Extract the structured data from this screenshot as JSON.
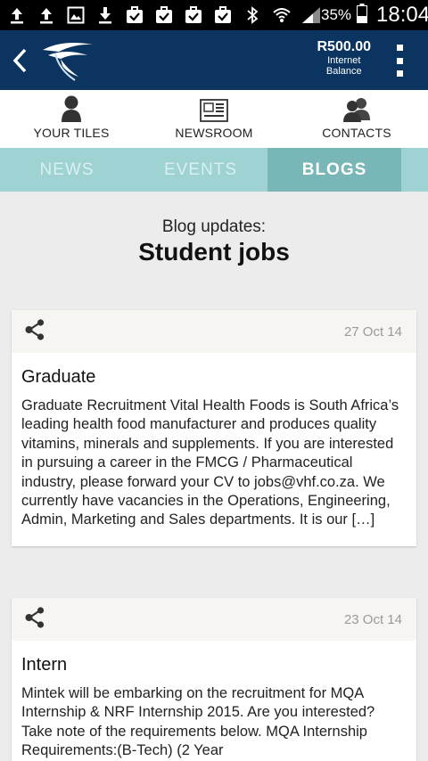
{
  "status_bar": {
    "icons": [
      "upload-icon",
      "upload-icon",
      "image-icon",
      "download-icon",
      "task-check-icon",
      "task-check-icon",
      "task-check-icon",
      "task-check-icon",
      "bluetooth-icon",
      "wifi-icon",
      "signal-icon"
    ],
    "battery": "35%",
    "time": "18:04"
  },
  "app_bar": {
    "balance_amount": "R500.00",
    "balance_label_1": "Internet",
    "balance_label_2": "Balance",
    "brand_color": "#0b3560"
  },
  "shortcuts": [
    {
      "label": "YOUR TILES",
      "icon": "person-icon"
    },
    {
      "label": "NEWSROOM",
      "icon": "newspaper-icon"
    },
    {
      "label": "CONTACTS",
      "icon": "contacts-icon"
    }
  ],
  "tabs": [
    {
      "label": "NEWS",
      "active": false
    },
    {
      "label": "EVENTS",
      "active": false
    },
    {
      "label": "BLOGS",
      "active": true
    }
  ],
  "heading": {
    "subtitle": "Blog updates:",
    "title": "Student jobs"
  },
  "posts": [
    {
      "date": "27 Oct 14",
      "title": "Graduate",
      "body": "Graduate Recruitment Vital Health Foods is South Africa’s leading health food manufacturer and produces quality vitamins, minerals and supplements. If you are interested in pursuing a career in the FMCG / Pharmaceutical industry, please forward your CV to jobs@vhf.co.za.  We currently have vacancies in the Operations, Engineering, Admin, Marketing and Sales departments.  It is our […]"
    },
    {
      "date": "23 Oct 14",
      "title": "Intern",
      "body": "Mintek will be embarking on the recruitment for MQA Internship &  NRF Internship 2015. Are you interested? Take note of the requirements below. MQA Internship Requirements:(B-Tech)  (2 Year"
    }
  ]
}
